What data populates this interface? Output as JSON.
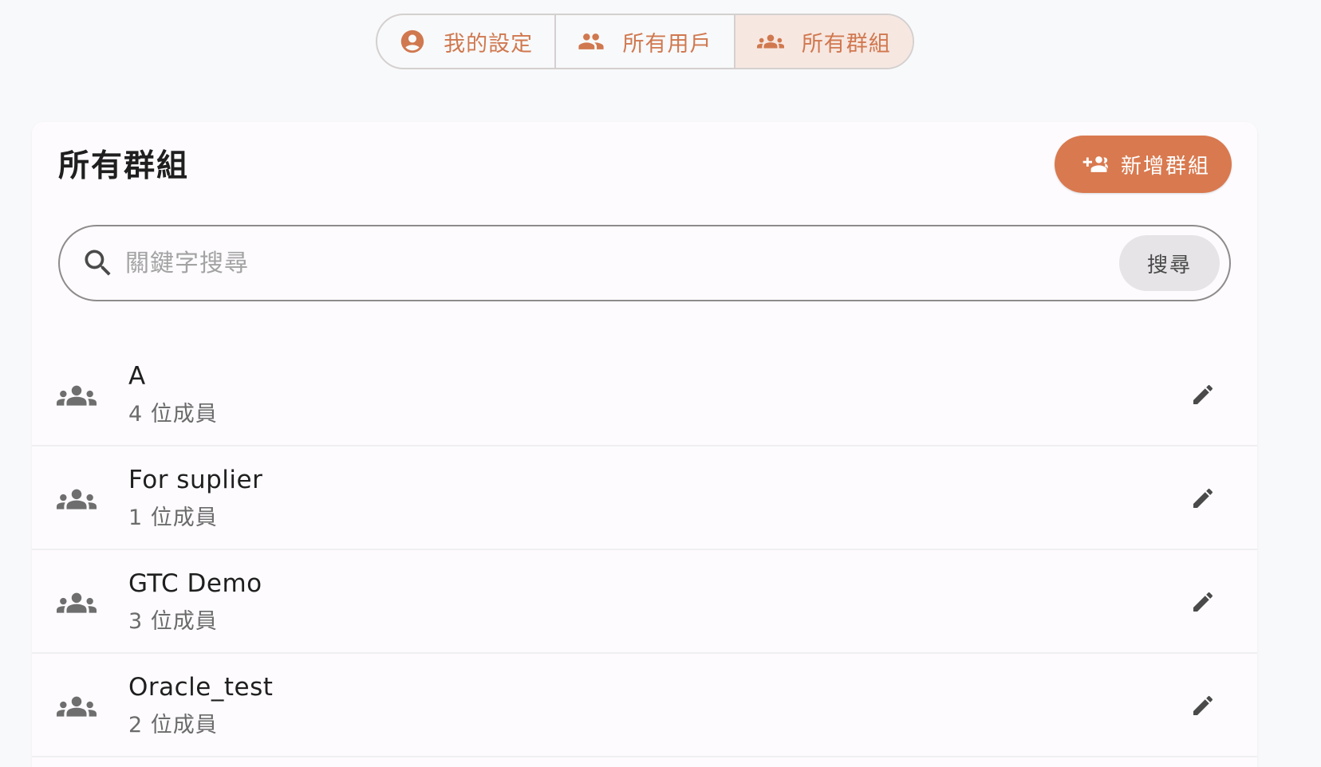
{
  "tabs": [
    {
      "label": "我的設定",
      "icon": "account-circle-icon",
      "active": false
    },
    {
      "label": "所有用戶",
      "icon": "people-icon",
      "active": false
    },
    {
      "label": "所有群組",
      "icon": "groups-icon",
      "active": true
    }
  ],
  "card": {
    "title": "所有群組",
    "add_button_label": "新增群組"
  },
  "search": {
    "placeholder": "關鍵字搜尋",
    "value": "",
    "button_label": "搜尋"
  },
  "groups": [
    {
      "name": "A",
      "members": "4 位成員"
    },
    {
      "name": "For suplier",
      "members": "1 位成員"
    },
    {
      "name": "GTC Demo",
      "members": "3 位成員"
    },
    {
      "name": "Oracle_test",
      "members": "2 位成員"
    }
  ],
  "colors": {
    "accent": "#d9794f",
    "accent_light": "#f7e7e1",
    "background": "#f8f9fa",
    "card": "#fdfbfe"
  }
}
